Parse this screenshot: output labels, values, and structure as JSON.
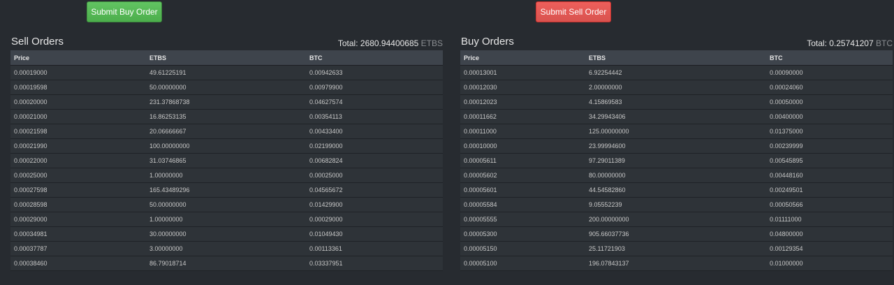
{
  "buttons": {
    "buy_label": "Submit Buy Order",
    "sell_label": "Submit Sell Order"
  },
  "sell_orders": {
    "title": "Sell Orders",
    "total_label": "Total:",
    "total_value": "2680.94400685",
    "total_unit": "ETBS",
    "columns": [
      "Price",
      "ETBS",
      "BTC"
    ],
    "rows": [
      [
        "0.00019000",
        "49.61225191",
        "0.00942633"
      ],
      [
        "0.00019598",
        "50.00000000",
        "0.00979900"
      ],
      [
        "0.00020000",
        "231.37868738",
        "0.04627574"
      ],
      [
        "0.00021000",
        "16.86253135",
        "0.00354113"
      ],
      [
        "0.00021598",
        "20.06666667",
        "0.00433400"
      ],
      [
        "0.00021990",
        "100.00000000",
        "0.02199000"
      ],
      [
        "0.00022000",
        "31.03746865",
        "0.00682824"
      ],
      [
        "0.00025000",
        "1.00000000",
        "0.00025000"
      ],
      [
        "0.00027598",
        "165.43489296",
        "0.04565672"
      ],
      [
        "0.00028598",
        "50.00000000",
        "0.01429900"
      ],
      [
        "0.00029000",
        "1.00000000",
        "0.00029000"
      ],
      [
        "0.00034981",
        "30.00000000",
        "0.01049430"
      ],
      [
        "0.00037787",
        "3.00000000",
        "0.00113361"
      ],
      [
        "0.00038460",
        "86.79018714",
        "0.03337951"
      ]
    ]
  },
  "buy_orders": {
    "title": "Buy Orders",
    "total_label": "Total:",
    "total_value": "0.25741207",
    "total_unit": "BTC",
    "columns": [
      "Price",
      "ETBS",
      "BTC"
    ],
    "rows": [
      [
        "0.00013001",
        "6.92254442",
        "0.00090000"
      ],
      [
        "0.00012030",
        "2.00000000",
        "0.00024060"
      ],
      [
        "0.00012023",
        "4.15869583",
        "0.00050000"
      ],
      [
        "0.00011662",
        "34.29943406",
        "0.00400000"
      ],
      [
        "0.00011000",
        "125.00000000",
        "0.01375000"
      ],
      [
        "0.00010000",
        "23.99994600",
        "0.00239999"
      ],
      [
        "0.00005611",
        "97.29011389",
        "0.00545895"
      ],
      [
        "0.00005602",
        "80.00000000",
        "0.00448160"
      ],
      [
        "0.00005601",
        "44.54582860",
        "0.00249501"
      ],
      [
        "0.00005584",
        "9.05552239",
        "0.00050566"
      ],
      [
        "0.00005555",
        "200.00000000",
        "0.01111000"
      ],
      [
        "0.00005300",
        "905.66037736",
        "0.04800000"
      ],
      [
        "0.00005150",
        "25.11721903",
        "0.00129354"
      ],
      [
        "0.00005100",
        "196.07843137",
        "0.01000000"
      ]
    ]
  }
}
